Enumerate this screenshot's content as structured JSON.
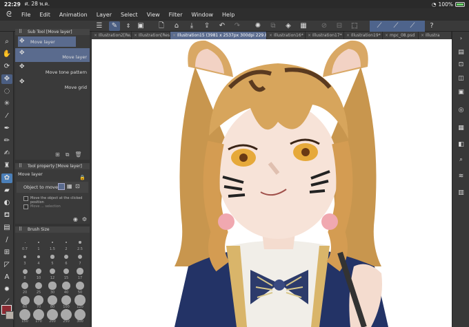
{
  "status": {
    "time": "22:29",
    "date": "ศ. 28 พ.ค.",
    "battery": "100%",
    "battery_level": 1.0
  },
  "menu": [
    "File",
    "Edit",
    "Animation",
    "Layer",
    "Select",
    "View",
    "Filter",
    "Window",
    "Help"
  ],
  "tabs": [
    {
      "label": "Illustration2[Re...",
      "active": false
    },
    {
      "label": "Illustration[Resi...",
      "active": false
    },
    {
      "label": "Illustration15 (3981 x 2537px 300dpi 229.8%)",
      "active": true
    },
    {
      "label": "Illustration16*",
      "active": false
    },
    {
      "label": "Illustration17*",
      "active": false
    },
    {
      "label": "Illustration19*",
      "active": false
    },
    {
      "label": "mpc_08.psd",
      "active": false
    },
    {
      "label": "Illustra",
      "active": false
    }
  ],
  "subtool": {
    "title": "Sub Tool [Move layer]",
    "group_label": "Move layer",
    "items": [
      "Move layer",
      "Move tone pattern",
      "Move grid"
    ]
  },
  "tool_property": {
    "title": "Tool property [Move layer]",
    "tool_name": "Move layer",
    "object_label": "Object to move",
    "checkbox_label": "Move the object at the clicked position",
    "checkbox2_label": "Move ... selection"
  },
  "brush_size": {
    "title": "Brush Size",
    "sizes": [
      "0.7",
      "1",
      "1.5",
      "2",
      "2.5",
      "3",
      "4",
      "5",
      "6",
      "7",
      "8",
      "10",
      "12",
      "15",
      "17",
      "20",
      "25",
      "30",
      "40",
      "50",
      "60",
      "70",
      "80",
      "100",
      "120",
      "150",
      "170",
      "200",
      "250",
      "300"
    ]
  },
  "colors": {
    "main": "#8c2a32",
    "sub": "#b8b0a8",
    "accent": "#5a6b8e"
  },
  "icons": {
    "left_tools": [
      "zoom-icon",
      "hand-icon",
      "rotate-icon",
      "move-icon",
      "lasso-icon",
      "magic-wand-icon",
      "eyedropper-icon",
      "pen-icon",
      "pencil-icon",
      "brush-icon",
      "airbrush-icon",
      "decoration-icon",
      "eraser-icon",
      "blend-icon",
      "fill-icon",
      "gradient-icon",
      "figure-icon",
      "frame-icon",
      "ruler-icon",
      "text-icon",
      "balloon-icon",
      "correct-line-icon"
    ],
    "right": [
      "layer-icon",
      "navigator-icon",
      "history-icon",
      "material-icon",
      "color-wheel-icon",
      "color-set-icon",
      "sub-view-icon",
      "search-icon",
      "timeline-icon",
      "layer-property-icon"
    ]
  }
}
